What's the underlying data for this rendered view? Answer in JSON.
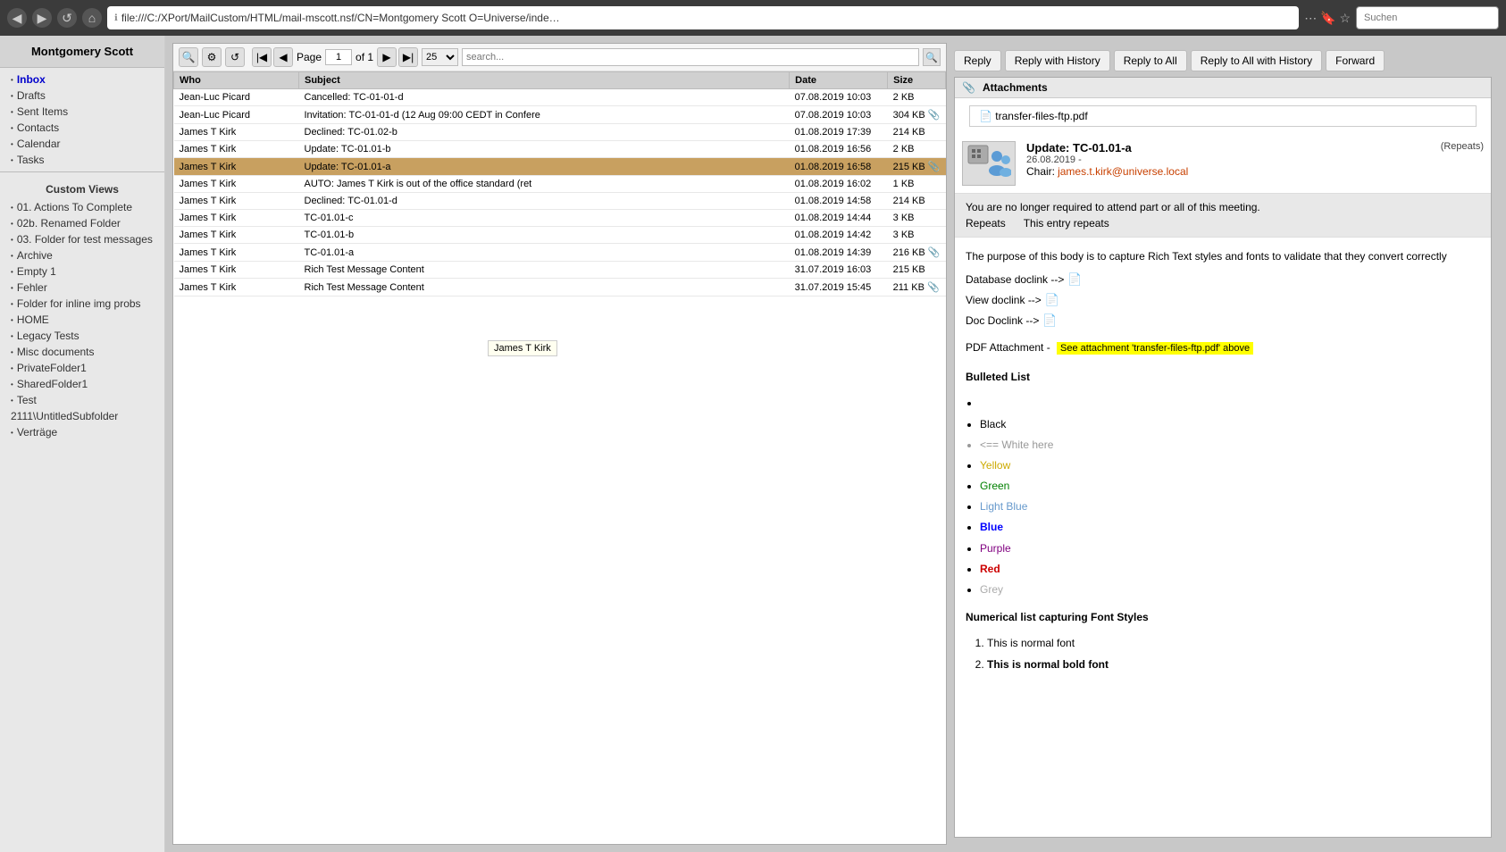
{
  "browser": {
    "address": "file:///C:/XPort/MailCustom/HTML/mail-mscott.nsf/CN=Montgomery Scott O=Universe/inde…",
    "search_placeholder": "Suchen",
    "nav_back": "◀",
    "nav_forward": "▶",
    "nav_reload": "↺",
    "nav_home": "⌂"
  },
  "sidebar": {
    "user_name": "Montgomery Scott",
    "folders": [
      {
        "label": "Inbox",
        "active": true
      },
      {
        "label": "Drafts",
        "active": false
      },
      {
        "label": "Sent Items",
        "active": false
      },
      {
        "label": "Contacts",
        "active": false
      },
      {
        "label": "Calendar",
        "active": false
      },
      {
        "label": "Tasks",
        "active": false
      }
    ],
    "custom_views_label": "Custom Views",
    "custom_views": [
      {
        "label": "01. Actions To Complete"
      },
      {
        "label": "02b. Renamed Folder"
      },
      {
        "label": "03. Folder for test messages"
      },
      {
        "label": "Archive"
      },
      {
        "label": "Empty 1"
      },
      {
        "label": "Fehler"
      },
      {
        "label": "Folder for inline img probs"
      },
      {
        "label": "HOME"
      },
      {
        "label": "Legacy Tests"
      },
      {
        "label": "Misc documents"
      },
      {
        "label": "PrivateFolder1"
      },
      {
        "label": "SharedFolder1"
      },
      {
        "label": "Test"
      },
      {
        "label": "2111\\UntitledSubfolder"
      },
      {
        "label": "Verträge"
      }
    ]
  },
  "mail_list": {
    "page_label": "Page",
    "page_current": "1",
    "page_total": "1",
    "per_page": "25",
    "search_placeholder": "search...",
    "columns": [
      "Who",
      "Subject",
      "Date",
      "Size"
    ],
    "rows": [
      {
        "who": "Jean-Luc Picard",
        "subject": "Cancelled: TC-01-01-d",
        "date": "07.08.2019 10:03",
        "size": "2 KB",
        "attachment": false,
        "selected": false,
        "unread": false
      },
      {
        "who": "Jean-Luc Picard",
        "subject": "Invitation: TC-01-01-d (12 Aug 09:00 CEDT in Confere",
        "date": "07.08.2019 10:03",
        "size": "304 KB",
        "attachment": true,
        "selected": false,
        "unread": false
      },
      {
        "who": "James T Kirk",
        "subject": "Declined: TC-01.02-b",
        "date": "01.08.2019 17:39",
        "size": "214 KB",
        "attachment": false,
        "selected": false,
        "unread": false
      },
      {
        "who": "James T Kirk",
        "subject": "Update: TC-01.01-b",
        "date": "01.08.2019 16:56",
        "size": "2 KB",
        "attachment": false,
        "selected": false,
        "unread": false
      },
      {
        "who": "James T Kirk",
        "subject": "Update: TC-01.01-a",
        "date": "01.08.2019 16:58",
        "size": "215 KB",
        "attachment": true,
        "selected": true,
        "unread": false
      },
      {
        "who": "James T Kirk",
        "subject": "AUTO: James T Kirk is out of the office standard (ret",
        "date": "01.08.2019 16:02",
        "size": "1 KB",
        "attachment": false,
        "selected": false,
        "unread": false
      },
      {
        "who": "James T Kirk",
        "subject": "Declined: TC-01.01-d",
        "date": "01.08.2019 14:58",
        "size": "214 KB",
        "attachment": false,
        "selected": false,
        "unread": false
      },
      {
        "who": "James T Kirk",
        "subject": "TC-01.01-c",
        "date": "01.08.2019 14:44",
        "size": "3 KB",
        "attachment": false,
        "selected": false,
        "unread": false
      },
      {
        "who": "James T Kirk",
        "subject": "TC-01.01-b",
        "date": "01.08.2019 14:42",
        "size": "3 KB",
        "attachment": false,
        "selected": false,
        "unread": false
      },
      {
        "who": "James T Kirk",
        "subject": "TC-01.01-a",
        "date": "01.08.2019 14:39",
        "size": "216 KB",
        "attachment": true,
        "selected": false,
        "unread": false
      },
      {
        "who": "James T Kirk",
        "subject": "Rich Test Message Content",
        "date": "31.07.2019 16:03",
        "size": "215 KB",
        "attachment": false,
        "selected": false,
        "unread": false
      },
      {
        "who": "James T Kirk",
        "subject": "Rich Test Message Content",
        "date": "31.07.2019 15:45",
        "size": "211 KB",
        "attachment": true,
        "selected": false,
        "unread": false
      }
    ],
    "tooltip": "James T Kirk"
  },
  "email_view": {
    "buttons": [
      "Reply",
      "Reply with History",
      "Reply to All",
      "Reply to All with History",
      "Forward"
    ],
    "attachments_label": "Attachments",
    "attachment_file": "transfer-files-ftp.pdf",
    "meeting_title": "Update: TC-01.01-a",
    "meeting_date": "26.08.2019 -",
    "meeting_repeats": "(Repeats)",
    "meeting_chair_label": "Chair:",
    "meeting_chair_email": "james.t.kirk@universe.local",
    "notice_text": "You are no longer required to attend part or all of this meeting.",
    "repeats_label": "Repeats",
    "repeats_value": "This entry repeats",
    "body_intro": "The purpose of this body is to capture Rich Text styles and fonts to validate that they convert correctly",
    "doclink1_label": "Database doclink -->",
    "doclink2_label": "View doclink -->",
    "doclink3_label": "Doc Doclink -->",
    "pdf_attachment_label": "PDF Attachment -",
    "pdf_attachment_link": "See attachment 'transfer-files-ftp.pdf' above",
    "bulleted_list_label": "Bulleted List",
    "list_items": [
      {
        "text": "",
        "color": "bullet-empty"
      },
      {
        "text": "Black",
        "color": "black"
      },
      {
        "text": "<== White here",
        "color": "white"
      },
      {
        "text": "Yellow",
        "color": "yellow"
      },
      {
        "text": "Green",
        "color": "green"
      },
      {
        "text": "Light Blue",
        "color": "lightblue"
      },
      {
        "text": "Blue",
        "color": "blue"
      },
      {
        "text": "Purple",
        "color": "purple"
      },
      {
        "text": "Red",
        "color": "red"
      },
      {
        "text": "Grey",
        "color": "grey"
      }
    ],
    "numerical_list_label": "Numerical list capturing Font Styles",
    "numerical_items": [
      {
        "text": "This is normal font"
      },
      {
        "text": "This is normal bold font"
      }
    ]
  }
}
